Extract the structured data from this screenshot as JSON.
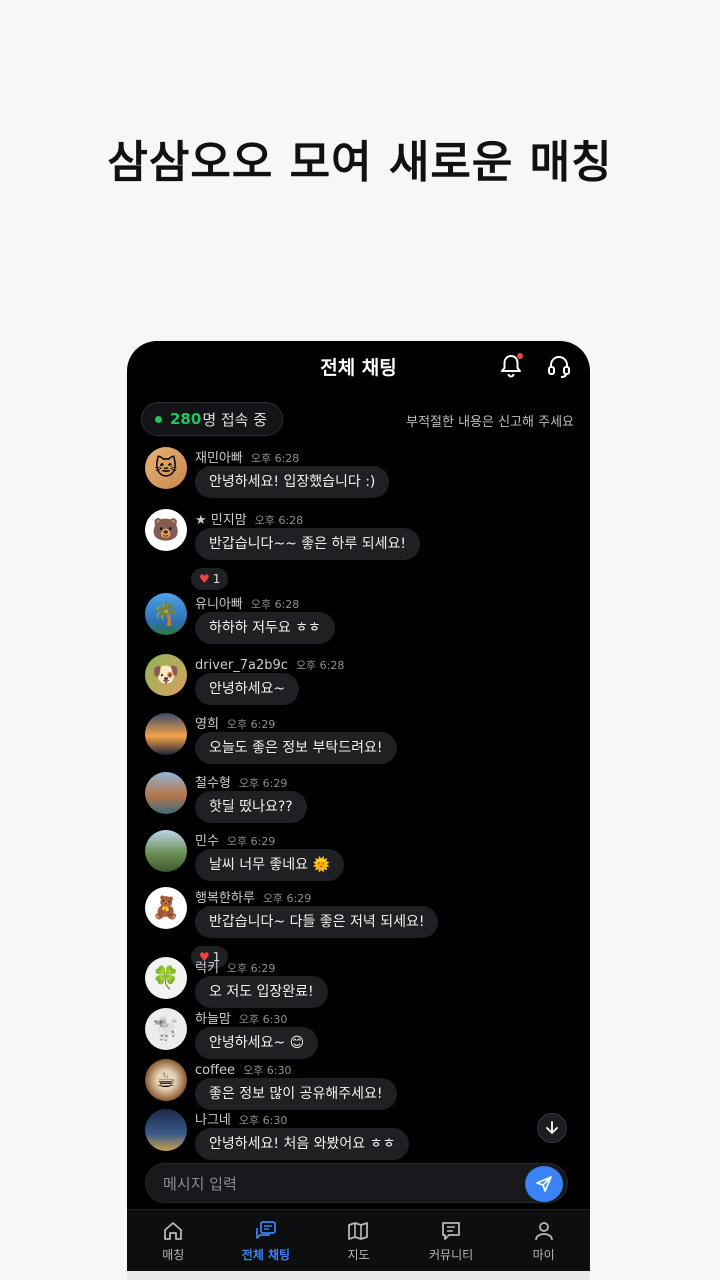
{
  "headline": "삼삼오오 모여 새로운 매칭",
  "header": {
    "title": "전체 채팅",
    "bell_icon": "bell-icon",
    "support_icon": "headset-icon",
    "notification_dot_color": "#ef4444"
  },
  "online": {
    "count": "280",
    "suffix": "명 접속 중",
    "status_color": "#22c55e"
  },
  "notice": "부적절한 내용은 신고해 주세요",
  "messages": [
    {
      "name": "재민아빠",
      "time": "오후 6:28",
      "text": "안녕하세요! 입장했습니다 :)",
      "avatar": "cat-avatar"
    },
    {
      "name": "★ 민지맘",
      "time": "오후 6:28",
      "text": "반갑습니다~~ 좋은 하루 되세요!",
      "avatar": "pink-bear-avatar",
      "reaction": "1"
    },
    {
      "name": "유니아빠",
      "time": "오후 6:28",
      "text": "하하하 저두요 ㅎㅎ",
      "avatar": "palm-tree-avatar"
    },
    {
      "name": "driver_7a2b9c",
      "time": "오후 6:28",
      "text": "안녕하세요~",
      "avatar": "puppy-avatar"
    },
    {
      "name": "영희",
      "time": "오후 6:29",
      "text": "오늘도 좋은 정보 부탁드려요!",
      "avatar": "sunset-avatar"
    },
    {
      "name": "철수형",
      "time": "오후 6:29",
      "text": "핫딜 떴나요??",
      "avatar": "canal-avatar"
    },
    {
      "name": "민수",
      "time": "오후 6:29",
      "text": "날씨 너무 좋네요 🌞",
      "avatar": "mountain-avatar"
    },
    {
      "name": "행복한하루",
      "time": "오후 6:29",
      "text": "반갑습니다~ 다들 좋은 저녁 되세요!",
      "avatar": "blue-bear-avatar",
      "reaction": "1"
    },
    {
      "name": "럭키",
      "time": "오후 6:29",
      "text": "오 저도 입장완료!",
      "avatar": "clover-avatar"
    },
    {
      "name": "하늘맘",
      "time": "오후 6:30",
      "text": "안녕하세요~ 😊",
      "avatar": "white-dog-avatar"
    },
    {
      "name": "coffee",
      "time": "오후 6:30",
      "text": "좋은 정보 많이 공유해주세요!",
      "avatar": "latte-avatar"
    },
    {
      "name": "나그네",
      "time": "오후 6:30",
      "text": "안녕하세요! 처음 와봤어요 ㅎㅎ",
      "avatar": "night-city-avatar"
    }
  ],
  "input": {
    "placeholder": "메시지 입력"
  },
  "tabs": [
    {
      "label": "매칭",
      "icon": "home-icon",
      "active": false
    },
    {
      "label": "전체 채팅",
      "icon": "chat-icon",
      "active": true
    },
    {
      "label": "지도",
      "icon": "map-icon",
      "active": false
    },
    {
      "label": "커뮤니티",
      "icon": "community-icon",
      "active": false
    },
    {
      "label": "마이",
      "icon": "person-icon",
      "active": false
    }
  ],
  "colors": {
    "accent": "#3b82f6",
    "background": "#000000"
  }
}
